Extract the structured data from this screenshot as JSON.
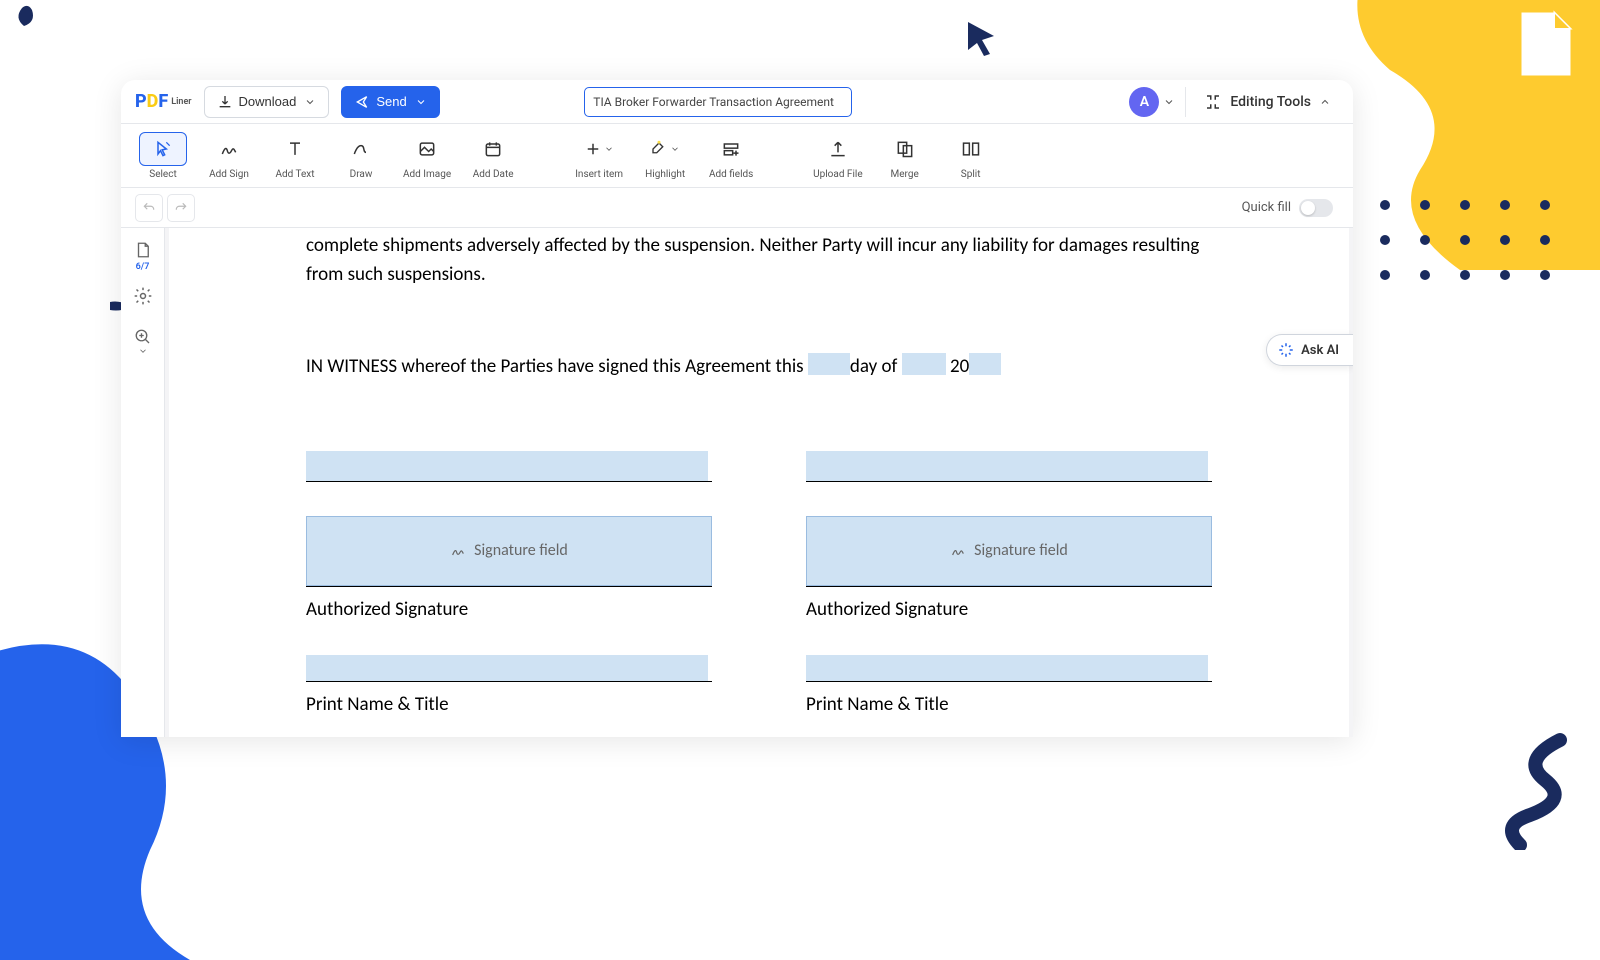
{
  "header": {
    "logo_text_p": "P",
    "logo_text_d": "D",
    "logo_text_f": "F",
    "logo_liner": "Liner",
    "download_label": "Download",
    "send_label": "Send",
    "filename": "TIA Broker Forwarder Transaction Agreement",
    "avatar_letter": "A",
    "editing_tools_label": "Editing Tools"
  },
  "toolbar": {
    "select": "Select",
    "add_sign": "Add Sign",
    "add_text": "Add Text",
    "draw": "Draw",
    "add_image": "Add Image",
    "add_date": "Add Date",
    "insert_item": "Insert item",
    "highlight": "Highlight",
    "add_fields": "Add fields",
    "upload_file": "Upload File",
    "merge": "Merge",
    "split": "Split"
  },
  "subbar": {
    "quick_fill_label": "Quick fill"
  },
  "sidebar": {
    "page_counter": "6/7"
  },
  "document": {
    "para1": "complete shipments adversely affected by the suspension. Neither Party will incur any liability for damages resulting from such suspensions.",
    "witness_prefix": "IN WITNESS whereof the Parties have signed this Agreement this ",
    "witness_day_of": "day of ",
    "witness_year_prefix": " 20",
    "signature_field_label": "Signature field",
    "authorized_signature_label": "Authorized Signature",
    "print_name_title_label": "Print Name & Title"
  },
  "ask_ai": {
    "label": "Ask AI"
  }
}
